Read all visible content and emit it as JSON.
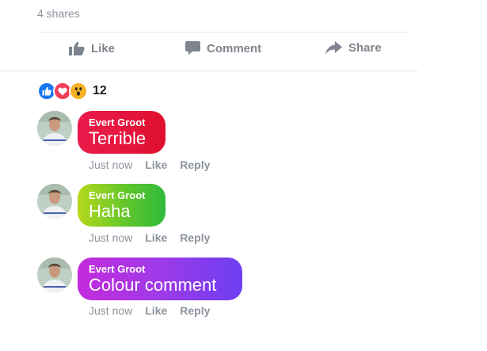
{
  "post": {
    "shares_text": "4 shares",
    "actions": {
      "like_label": "Like",
      "comment_label": "Comment",
      "share_label": "Share"
    },
    "reactions": {
      "types": [
        "like",
        "love",
        "wow"
      ],
      "count": "12"
    }
  },
  "comments": [
    {
      "author": "Evert Groot",
      "text": "Terrible",
      "time": "Just now",
      "like_label": "Like",
      "reply_label": "Reply",
      "bubble_color": "#e5163a"
    },
    {
      "author": "Evert Groot",
      "text": "Haha",
      "time": "Just now",
      "like_label": "Like",
      "reply_label": "Reply",
      "bubble_color": "#5cc62c"
    },
    {
      "author": "Evert Groot",
      "text": "Colour comment",
      "time": "Just now",
      "like_label": "Like",
      "reply_label": "Reply",
      "bubble_color": "#a23be8"
    }
  ],
  "colors": {
    "muted_text": "#8d949e",
    "like_blue": "#1877f2",
    "love_red": "#f33e58",
    "wow_yellow": "#f7b125"
  }
}
